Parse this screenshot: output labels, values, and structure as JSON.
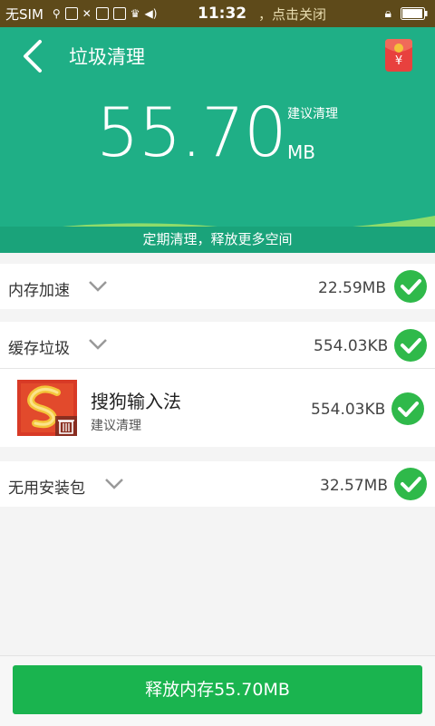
{
  "status_bar": {
    "carrier": "无SIM",
    "time": "11:32",
    "notice": "，点击关闭"
  },
  "header": {
    "title": "垃圾清理",
    "amount": "55.70",
    "suggest": "建议清理",
    "unit": "MB",
    "tagline": "定期清理，释放更多空间",
    "red_packet_symbol": "¥"
  },
  "rows": [
    {
      "label": "内存加速",
      "size": "22.59MB"
    },
    {
      "label": "缓存垃圾",
      "size": "554.03KB"
    },
    {
      "label": "无用安装包",
      "size": "32.57MB"
    }
  ],
  "app_item": {
    "name": "搜狗输入法",
    "sub": "建议清理",
    "size": "554.03KB"
  },
  "footer": {
    "button_label": "释放内存55.70MB"
  },
  "colors": {
    "header_green": "#1faf86",
    "button_green": "#1ab44f",
    "check_green": "#2fb94a"
  }
}
